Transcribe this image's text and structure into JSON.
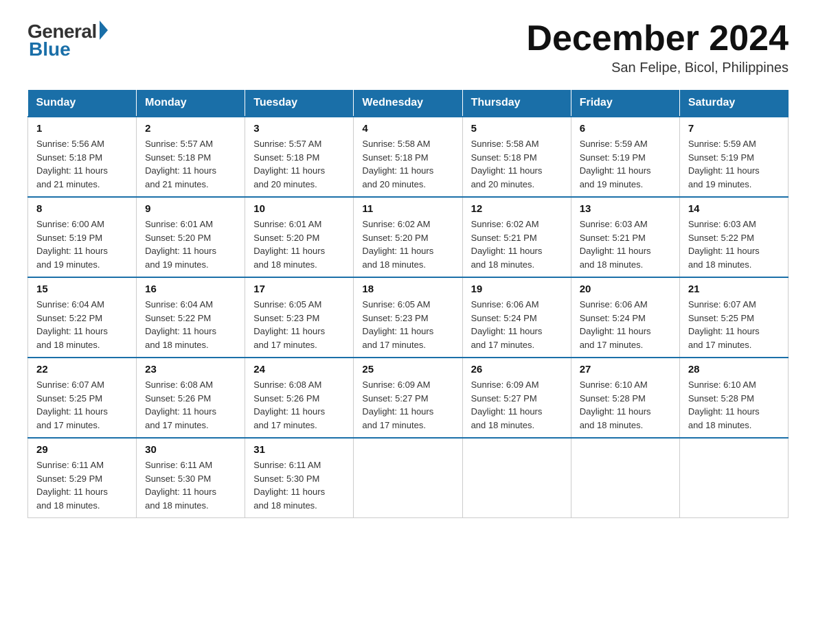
{
  "logo": {
    "general": "General",
    "blue": "Blue"
  },
  "title": "December 2024",
  "location": "San Felipe, Bicol, Philippines",
  "days_of_week": [
    "Sunday",
    "Monday",
    "Tuesday",
    "Wednesday",
    "Thursday",
    "Friday",
    "Saturday"
  ],
  "weeks": [
    [
      {
        "day": "1",
        "sunrise": "5:56 AM",
        "sunset": "5:18 PM",
        "daylight": "11 hours and 21 minutes."
      },
      {
        "day": "2",
        "sunrise": "5:57 AM",
        "sunset": "5:18 PM",
        "daylight": "11 hours and 21 minutes."
      },
      {
        "day": "3",
        "sunrise": "5:57 AM",
        "sunset": "5:18 PM",
        "daylight": "11 hours and 20 minutes."
      },
      {
        "day": "4",
        "sunrise": "5:58 AM",
        "sunset": "5:18 PM",
        "daylight": "11 hours and 20 minutes."
      },
      {
        "day": "5",
        "sunrise": "5:58 AM",
        "sunset": "5:18 PM",
        "daylight": "11 hours and 20 minutes."
      },
      {
        "day": "6",
        "sunrise": "5:59 AM",
        "sunset": "5:19 PM",
        "daylight": "11 hours and 19 minutes."
      },
      {
        "day": "7",
        "sunrise": "5:59 AM",
        "sunset": "5:19 PM",
        "daylight": "11 hours and 19 minutes."
      }
    ],
    [
      {
        "day": "8",
        "sunrise": "6:00 AM",
        "sunset": "5:19 PM",
        "daylight": "11 hours and 19 minutes."
      },
      {
        "day": "9",
        "sunrise": "6:01 AM",
        "sunset": "5:20 PM",
        "daylight": "11 hours and 19 minutes."
      },
      {
        "day": "10",
        "sunrise": "6:01 AM",
        "sunset": "5:20 PM",
        "daylight": "11 hours and 18 minutes."
      },
      {
        "day": "11",
        "sunrise": "6:02 AM",
        "sunset": "5:20 PM",
        "daylight": "11 hours and 18 minutes."
      },
      {
        "day": "12",
        "sunrise": "6:02 AM",
        "sunset": "5:21 PM",
        "daylight": "11 hours and 18 minutes."
      },
      {
        "day": "13",
        "sunrise": "6:03 AM",
        "sunset": "5:21 PM",
        "daylight": "11 hours and 18 minutes."
      },
      {
        "day": "14",
        "sunrise": "6:03 AM",
        "sunset": "5:22 PM",
        "daylight": "11 hours and 18 minutes."
      }
    ],
    [
      {
        "day": "15",
        "sunrise": "6:04 AM",
        "sunset": "5:22 PM",
        "daylight": "11 hours and 18 minutes."
      },
      {
        "day": "16",
        "sunrise": "6:04 AM",
        "sunset": "5:22 PM",
        "daylight": "11 hours and 18 minutes."
      },
      {
        "day": "17",
        "sunrise": "6:05 AM",
        "sunset": "5:23 PM",
        "daylight": "11 hours and 17 minutes."
      },
      {
        "day": "18",
        "sunrise": "6:05 AM",
        "sunset": "5:23 PM",
        "daylight": "11 hours and 17 minutes."
      },
      {
        "day": "19",
        "sunrise": "6:06 AM",
        "sunset": "5:24 PM",
        "daylight": "11 hours and 17 minutes."
      },
      {
        "day": "20",
        "sunrise": "6:06 AM",
        "sunset": "5:24 PM",
        "daylight": "11 hours and 17 minutes."
      },
      {
        "day": "21",
        "sunrise": "6:07 AM",
        "sunset": "5:25 PM",
        "daylight": "11 hours and 17 minutes."
      }
    ],
    [
      {
        "day": "22",
        "sunrise": "6:07 AM",
        "sunset": "5:25 PM",
        "daylight": "11 hours and 17 minutes."
      },
      {
        "day": "23",
        "sunrise": "6:08 AM",
        "sunset": "5:26 PM",
        "daylight": "11 hours and 17 minutes."
      },
      {
        "day": "24",
        "sunrise": "6:08 AM",
        "sunset": "5:26 PM",
        "daylight": "11 hours and 17 minutes."
      },
      {
        "day": "25",
        "sunrise": "6:09 AM",
        "sunset": "5:27 PM",
        "daylight": "11 hours and 17 minutes."
      },
      {
        "day": "26",
        "sunrise": "6:09 AM",
        "sunset": "5:27 PM",
        "daylight": "11 hours and 18 minutes."
      },
      {
        "day": "27",
        "sunrise": "6:10 AM",
        "sunset": "5:28 PM",
        "daylight": "11 hours and 18 minutes."
      },
      {
        "day": "28",
        "sunrise": "6:10 AM",
        "sunset": "5:28 PM",
        "daylight": "11 hours and 18 minutes."
      }
    ],
    [
      {
        "day": "29",
        "sunrise": "6:11 AM",
        "sunset": "5:29 PM",
        "daylight": "11 hours and 18 minutes."
      },
      {
        "day": "30",
        "sunrise": "6:11 AM",
        "sunset": "5:30 PM",
        "daylight": "11 hours and 18 minutes."
      },
      {
        "day": "31",
        "sunrise": "6:11 AM",
        "sunset": "5:30 PM",
        "daylight": "11 hours and 18 minutes."
      },
      null,
      null,
      null,
      null
    ]
  ],
  "labels": {
    "sunrise": "Sunrise:",
    "sunset": "Sunset:",
    "daylight": "Daylight:"
  }
}
